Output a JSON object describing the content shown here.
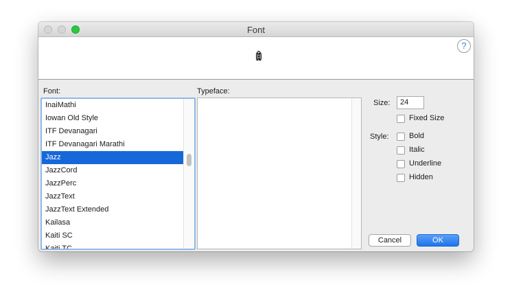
{
  "window": {
    "title": "Font"
  },
  "preview": {
    "sample_text": "ꂉ"
  },
  "help": {
    "label": "?"
  },
  "font_panel": {
    "label": "Font:",
    "items": [
      "InaiMathi",
      "Iowan Old Style",
      "ITF Devanagari",
      "ITF Devanagari Marathi",
      "Jazz",
      "JazzCord",
      "JazzPerc",
      "JazzText",
      "JazzText Extended",
      "Kailasa",
      "Kaiti SC",
      "Kaiti TC"
    ],
    "selected": "Jazz"
  },
  "typeface_panel": {
    "label": "Typeface:",
    "items": []
  },
  "size": {
    "label": "Size:",
    "value": "24"
  },
  "fixed_size": {
    "label": "Fixed Size",
    "checked": false
  },
  "style": {
    "label": "Style:",
    "options": [
      "Bold",
      "Italic",
      "Underline",
      "Hidden"
    ]
  },
  "buttons": {
    "cancel": "Cancel",
    "ok": "OK"
  },
  "colors": {
    "selection": "#1668d8",
    "ok_button": "#1f73ea",
    "zoom_button": "#2cc840"
  }
}
